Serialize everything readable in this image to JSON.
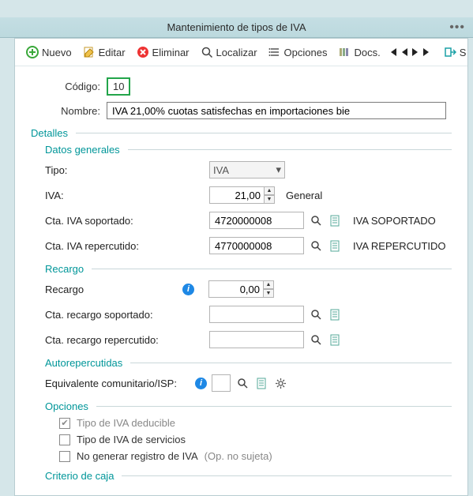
{
  "menubar": {
    "items": [
      "",
      "",
      "",
      ""
    ]
  },
  "window": {
    "title": "Mantenimiento de tipos de IVA"
  },
  "toolbar": {
    "nuevo": "Nuevo",
    "editar": "Editar",
    "eliminar": "Eliminar",
    "localizar": "Localizar",
    "opciones": "Opciones",
    "docs": "Docs.",
    "s": "S"
  },
  "header": {
    "codigo_label": "Código:",
    "codigo_value": "10",
    "nombre_label": "Nombre:",
    "nombre_value": "IVA 21,00% cuotas satisfechas en importaciones bie"
  },
  "sections": {
    "detalles": "Detalles",
    "datos_generales": "Datos generales",
    "recargo": "Recargo",
    "autorepercutidas": "Autorepercutidas",
    "opciones": "Opciones",
    "criterio_caja": "Criterio de caja"
  },
  "datos": {
    "tipo_label": "Tipo:",
    "tipo_value": "IVA",
    "iva_label": "IVA:",
    "iva_value": "21,00",
    "iva_desc": "General",
    "cta_sop_label": "Cta. IVA soportado:",
    "cta_sop_value": "4720000008",
    "cta_sop_desc": "IVA SOPORTADO",
    "cta_rep_label": "Cta. IVA repercutido:",
    "cta_rep_value": "4770000008",
    "cta_rep_desc": "IVA REPERCUTIDO"
  },
  "recargo": {
    "recargo_label": "Recargo",
    "recargo_value": "0,00",
    "cta_sop_label": "Cta. recargo soportado:",
    "cta_sop_value": "",
    "cta_rep_label": "Cta. recargo repercutido:",
    "cta_rep_value": ""
  },
  "auto": {
    "equiv_label": "Equivalente comunitario/ISP:",
    "equiv_value": ""
  },
  "options": {
    "deducible": "Tipo de IVA deducible",
    "servicios": "Tipo de IVA de servicios",
    "no_generar": "No generar registro de IVA",
    "no_generar_note": "(Op. no sujeta)"
  }
}
